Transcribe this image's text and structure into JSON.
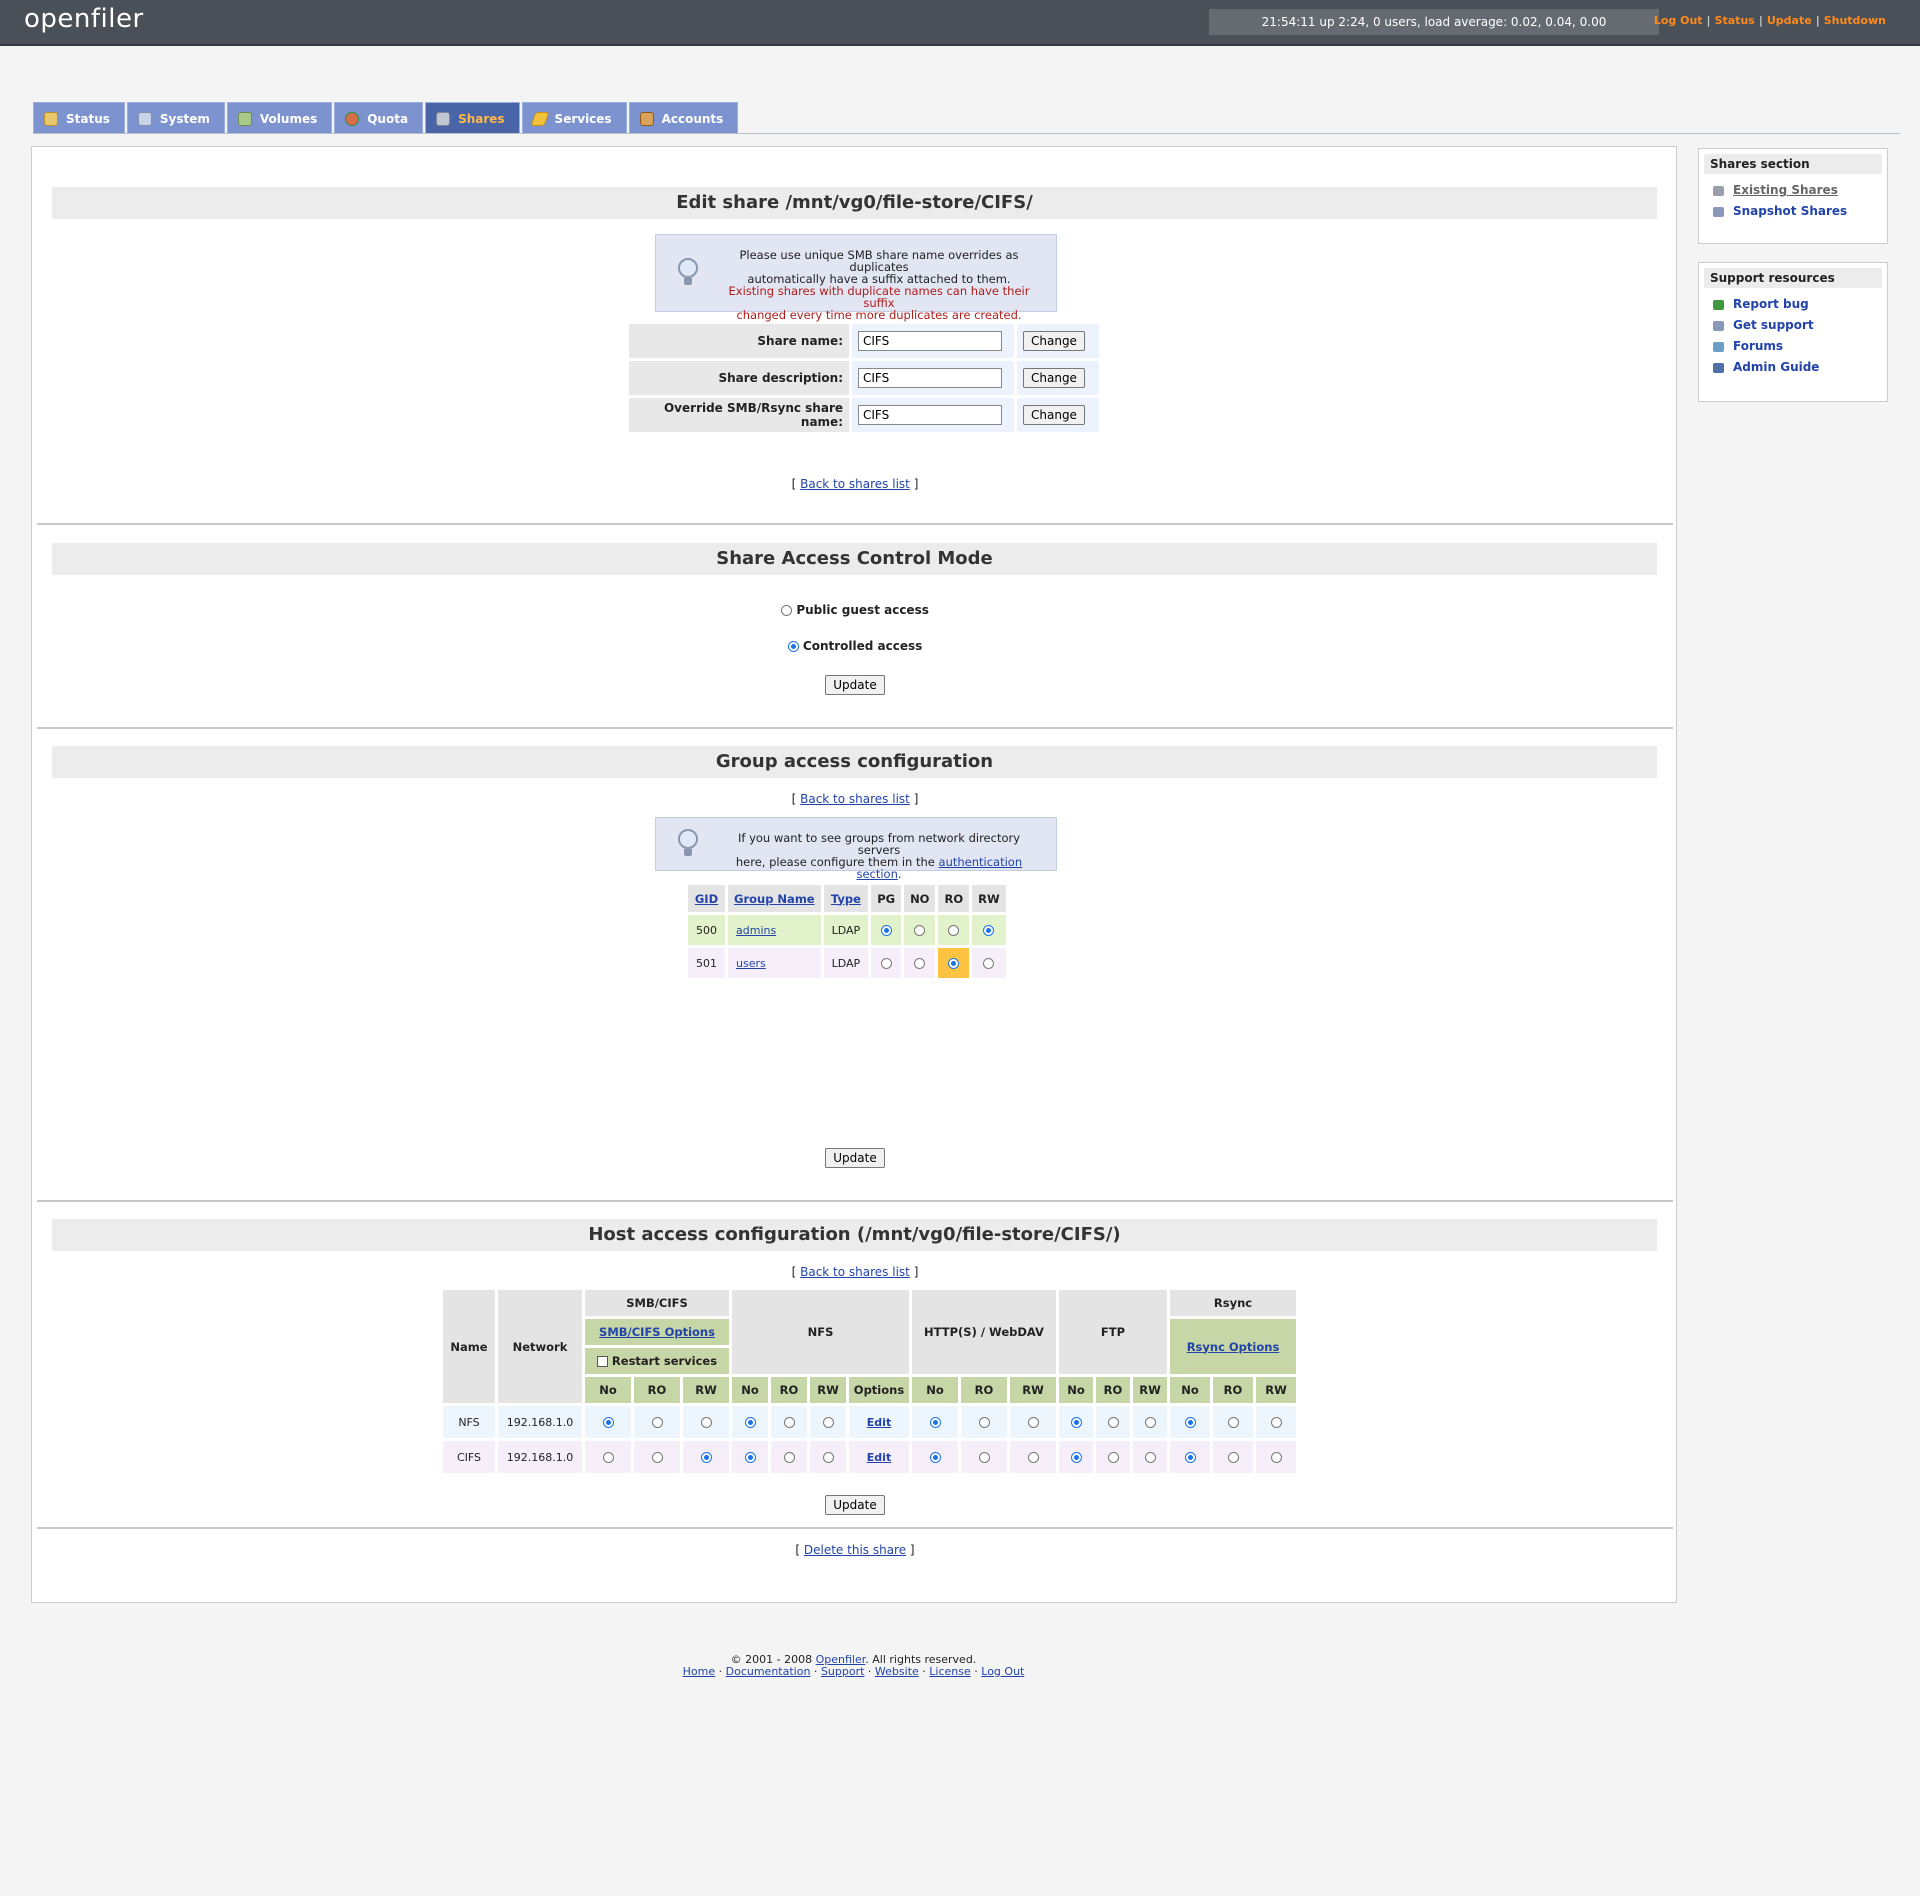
{
  "header": {
    "logo": "openfiler",
    "uptime": "21:54:11 up 2:24, 0 users, load average: 0.02, 0.04, 0.00",
    "links": [
      "Log Out",
      "Status",
      "Update",
      "Shutdown"
    ]
  },
  "tabs": [
    {
      "label": "Status",
      "icon": "status-icon"
    },
    {
      "label": "System",
      "icon": "system-icon"
    },
    {
      "label": "Volumes",
      "icon": "volumes-icon"
    },
    {
      "label": "Quota",
      "icon": "quota-icon"
    },
    {
      "label": "Shares",
      "icon": "shares-icon",
      "active": true
    },
    {
      "label": "Services",
      "icon": "services-icon"
    },
    {
      "label": "Accounts",
      "icon": "accounts-icon"
    }
  ],
  "edit": {
    "title": "Edit share /mnt/vg0/file-store/CIFS/",
    "tip_line1": "Please use unique SMB share name overrides as duplicates",
    "tip_line2": "automatically have a suffix attached to them.",
    "tip_line3": "Existing shares with duplicate names can have their suffix",
    "tip_line4": "changed every time more duplicates are created.",
    "fields": [
      {
        "label": "Share name:",
        "value": "CIFS",
        "button": "Change"
      },
      {
        "label": "Share description:",
        "value": "CIFS",
        "button": "Change"
      },
      {
        "label": "Override SMB/Rsync share name:",
        "value": "CIFS",
        "button": "Change"
      }
    ],
    "back_link": "Back to shares list"
  },
  "access_mode": {
    "title": "Share Access Control Mode",
    "option_public": "Public guest access",
    "option_controlled": "Controlled access",
    "selected": "Controlled access",
    "update": "Update"
  },
  "group_access": {
    "title": "Group access configuration",
    "back_link": "Back to shares list",
    "tip_line1": "If you want to see groups from network directory servers",
    "tip_line2_prefix": "here, please configure them in the",
    "tip_link": "authentication section",
    "tip_suffix": ".",
    "columns": [
      "GID",
      "Group Name",
      "Type",
      "PG",
      "NO",
      "RO",
      "RW"
    ],
    "rows": [
      {
        "gid": "500",
        "name": "admins",
        "type": "LDAP",
        "pg": true,
        "no": false,
        "ro": false,
        "rw": true
      },
      {
        "gid": "501",
        "name": "users",
        "type": "LDAP",
        "pg": false,
        "no": false,
        "ro": true,
        "rw": false
      }
    ],
    "update": "Update"
  },
  "host_access": {
    "title": "Host access configuration (/mnt/vg0/file-store/CIFS/)",
    "back_link": "Back to shares list",
    "col_name": "Name",
    "col_network": "Network",
    "smb_header": "SMB/CIFS",
    "smb_options": "SMB/CIFS Options",
    "restart_services": "Restart services",
    "nfs_header": "NFS",
    "http_header": "HTTP(S) / WebDAV",
    "ftp_header": "FTP",
    "rsync_header": "Rsync",
    "rsync_options": "Rsync Options",
    "sub": {
      "no": "No",
      "ro": "RO",
      "rw": "RW",
      "options": "Options"
    },
    "rows": [
      {
        "name": "NFS",
        "network": "192.168.1.0",
        "smb": "No",
        "nfs": "No",
        "nfs_edit": "Edit",
        "http": "No",
        "ftp": "No",
        "rsync": "No"
      },
      {
        "name": "CIFS",
        "network": "192.168.1.0",
        "smb": "RW",
        "nfs": "No",
        "nfs_edit": "Edit",
        "http": "No",
        "ftp": "No",
        "rsync": "No"
      }
    ],
    "update": "Update",
    "delete_link": "Delete this share"
  },
  "sidebar": {
    "shares_title": "Shares section",
    "shares_items": [
      "Existing Shares",
      "Snapshot Shares"
    ],
    "support_title": "Support resources",
    "support_items": [
      "Report bug",
      "Get support",
      "Forums",
      "Admin Guide"
    ]
  },
  "footer": {
    "copyright_prefix": "© 2001 - 2008",
    "brand": "Openfiler",
    "copyright_suffix": ". All rights reserved.",
    "links": [
      "Home",
      "Documentation",
      "Support",
      "Website",
      "License",
      "Log Out"
    ]
  }
}
